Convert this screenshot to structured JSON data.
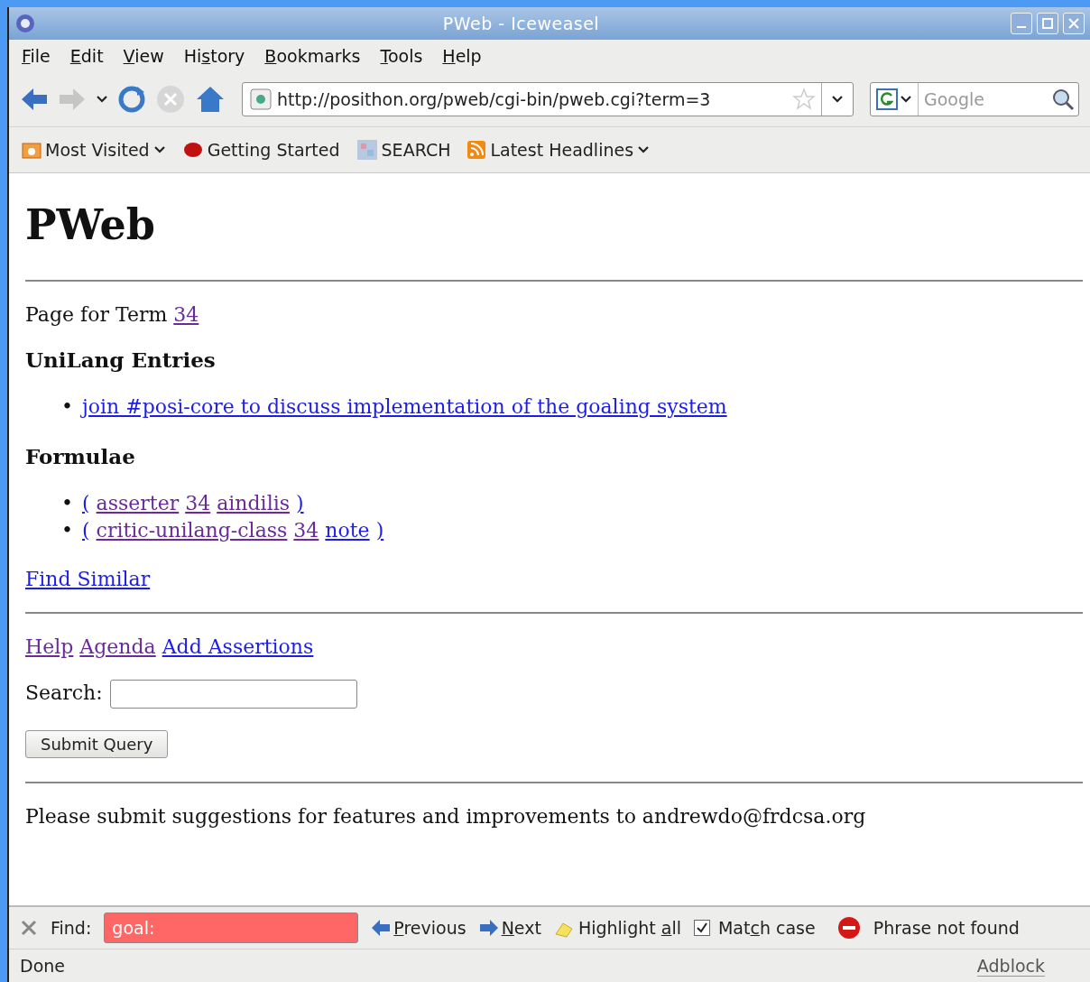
{
  "window": {
    "title": "PWeb - Iceweasel"
  },
  "menu": [
    {
      "key": "F",
      "after": "ile"
    },
    {
      "key": "E",
      "after": "dit"
    },
    {
      "key": "V",
      "after": "iew"
    },
    {
      "before": "Hi",
      "key": "s",
      "after": "tory"
    },
    {
      "key": "B",
      "after": "ookmarks"
    },
    {
      "key": "T",
      "after": "ools"
    },
    {
      "key": "H",
      "after": "elp"
    }
  ],
  "navigation": {
    "url": "http://posithon.org/pweb/cgi-bin/pweb.cgi?term=3",
    "search_placeholder": "Google",
    "forward_disabled": true,
    "stop_disabled": true
  },
  "bookmarks": [
    {
      "label": "Most Visited",
      "kind": "folder"
    },
    {
      "label": "Getting Started",
      "kind": "page"
    },
    {
      "label": "SEARCH",
      "kind": "search"
    },
    {
      "label": "Latest Headlines",
      "kind": "feed"
    }
  ],
  "page": {
    "heading": "PWeb",
    "term_line": {
      "text": "Page for Term",
      "link": {
        "text": "34",
        "visited": true
      }
    },
    "sections": [
      {
        "title": "UniLang Entries",
        "items": [
          {
            "bullet": "•",
            "links": [
              {
                "text": "join #posi-core to discuss implementation of the goaling system",
                "visited": false
              }
            ]
          }
        ]
      },
      {
        "title": "Formulae",
        "items": [
          {
            "bullet": "•",
            "links": [
              {
                "text": "(",
                "visited": false
              },
              {
                "text": "asserter",
                "visited": true
              },
              {
                "text": "34",
                "visited": true
              },
              {
                "text": "aindilis",
                "visited": true
              },
              {
                "text": ")",
                "visited": false
              }
            ]
          },
          {
            "bullet": "•",
            "links": [
              {
                "text": "(",
                "visited": false
              },
              {
                "text": "critic-unilang-class",
                "visited": true
              },
              {
                "text": "34",
                "visited": true
              },
              {
                "text": "note",
                "visited": false
              },
              {
                "text": ")",
                "visited": false
              }
            ]
          }
        ]
      }
    ],
    "find_similar": {
      "text": "Find Similar",
      "visited": false
    },
    "footer_links": [
      {
        "text": "Help",
        "visited": true
      },
      {
        "text": "Agenda",
        "visited": true
      },
      {
        "text": "Add Assertions",
        "visited": false
      }
    ],
    "search_label": "Search:",
    "submit": "Submit Query",
    "contact": "Please submit suggestions for features and improvements to andrewdo@frdcsa.org"
  },
  "find_bar": {
    "label": "Find:",
    "value": "goal:",
    "not_found": true,
    "buttons": [
      {
        "key": "P",
        "after": "revious",
        "kind": "previous"
      },
      {
        "key": "N",
        "after": "ext",
        "kind": "next"
      },
      {
        "before": "Highlight ",
        "key": "a",
        "after": "ll",
        "kind": "highlight"
      }
    ],
    "match_case": {
      "before": "Mat",
      "key": "c",
      "after": "h case",
      "checked": true
    },
    "message": "Phrase not found"
  },
  "status_bar": {
    "text": "Done",
    "addon": "Adblock"
  }
}
